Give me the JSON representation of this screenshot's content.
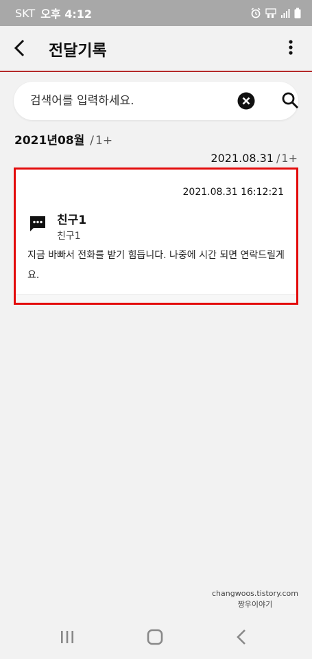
{
  "status_bar": {
    "carrier": "SKT",
    "time": "오후 4:12",
    "icons": [
      "alarm-icon",
      "volte-icon",
      "signal-icon",
      "battery-icon"
    ]
  },
  "app_bar": {
    "title": "전달기록",
    "back_icon": "chevron-left-icon",
    "menu_icon": "more-vertical-icon",
    "divider_color": "#b52a2a"
  },
  "search": {
    "placeholder": "검색어를 입력하세요.",
    "value": ""
  },
  "list": {
    "month_label": "2021년08월",
    "month_separator": "/",
    "month_count": "1+",
    "date_label": "2021.08.31",
    "date_separator": "/",
    "date_count": "1+",
    "items": [
      {
        "timestamp": "2021.08.31 16:12:21",
        "sender": "친구1",
        "sender_sub": "친구1",
        "message": "지금 바빠서 전화를 받기 힘듭니다. 나중에 시간 되면 연락드릴게요.",
        "icon": "message-icon"
      }
    ]
  },
  "highlight_color": "#e30b0b",
  "watermark": {
    "line1": "changwoos.tistory.com",
    "line2": "짱우이야기"
  },
  "nav_bar": {
    "icons": [
      "recent-apps-icon",
      "home-icon",
      "back-icon"
    ]
  }
}
